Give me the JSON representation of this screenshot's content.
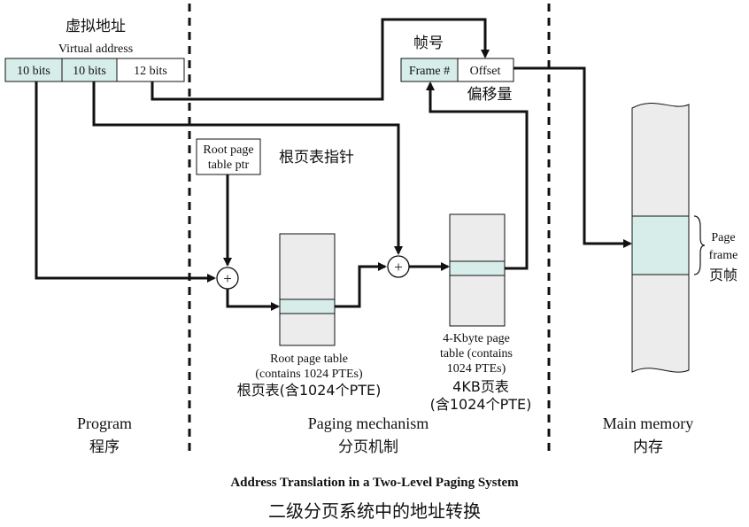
{
  "colors": {
    "highlight": "#d7ede9",
    "memory": "#ececec",
    "line": "#111111"
  },
  "virtual_address": {
    "label_cn": "虚拟地址",
    "label_en": "Virtual address",
    "fields": [
      "10 bits",
      "10 bits",
      "12 bits"
    ]
  },
  "physical_address": {
    "label_cn": "帧号",
    "frame_field": "Frame #",
    "offset_field": "Offset",
    "offset_cn": "偏移量"
  },
  "root_ptr": {
    "line1": "Root page",
    "line2": "table ptr",
    "cn": "根页表指针"
  },
  "root_table": {
    "line1": "Root page table",
    "line2": "(contains 1024 PTEs)",
    "cn": "根页表(含1024个PTE)"
  },
  "page_table": {
    "line1": "4-Kbyte page",
    "line2": "table (contains",
    "line3": "1024 PTEs)",
    "cn1": "4KB页表",
    "cn2": "(含1024个PTE)"
  },
  "adder_symbol": "+",
  "page_frame": {
    "line1": "Page",
    "line2": "frame",
    "cn": "页帧"
  },
  "sections": [
    {
      "en": "Program",
      "cn": "程序"
    },
    {
      "en": "Paging mechanism",
      "cn": "分页机制"
    },
    {
      "en": "Main memory",
      "cn": "内存"
    }
  ],
  "caption": {
    "en": "Address Translation in a Two-Level Paging System",
    "cn": "二级分页系统中的地址转换"
  }
}
